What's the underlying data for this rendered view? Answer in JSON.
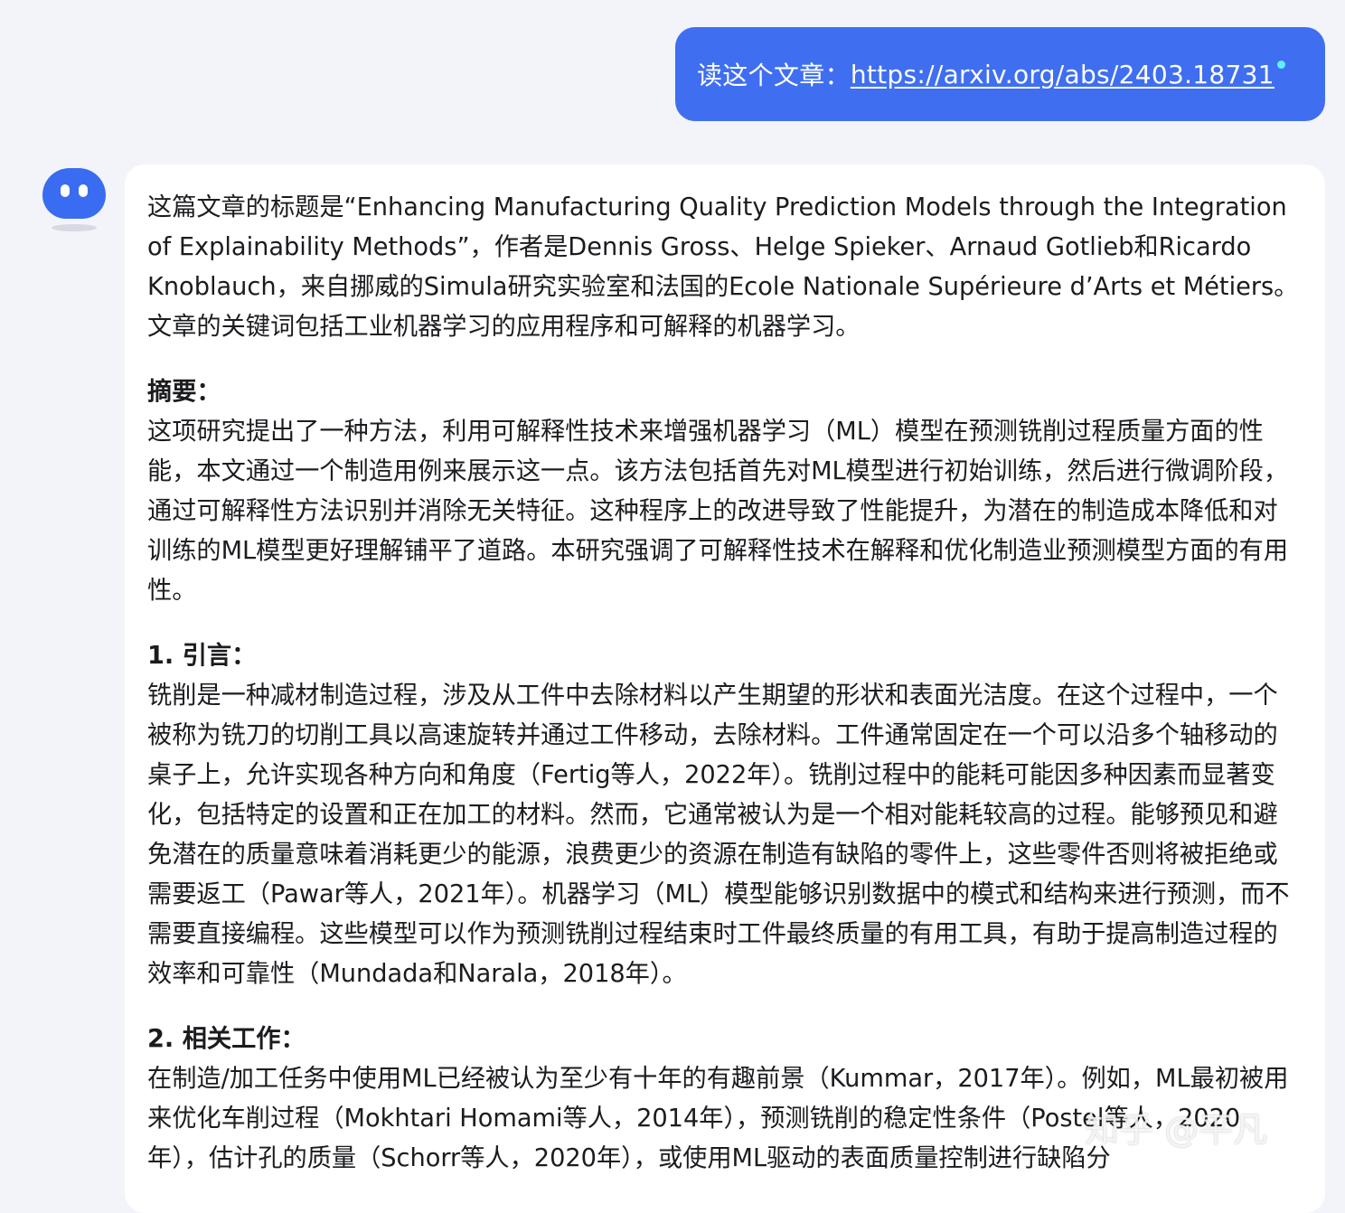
{
  "user_message": {
    "prefix": "读这个文章：",
    "link_text": "https://arxiv.org/abs/2403.18731"
  },
  "assistant_message": {
    "intro": "这篇文章的标题是“Enhancing Manufacturing Quality Prediction Models through the Integration of Explainability Methods”，作者是Dennis Gross、Helge Spieker、Arnaud Gotlieb和Ricardo Knoblauch，来自挪威的Simula研究实验室和法国的Ecole Nationale Supérieure d’Arts et Métiers。文章的关键词包括工业机器学习的应用程序和可解释的机器学习。",
    "sections": [
      {
        "title": "摘要：",
        "body": "这项研究提出了一种方法，利用可解释性技术来增强机器学习（ML）模型在预测铣削过程质量方面的性能，本文通过一个制造用例来展示这一点。该方法包括首先对ML模型进行初始训练，然后进行微调阶段，通过可解释性方法识别并消除无关特征。这种程序上的改进导致了性能提升，为潜在的制造成本降低和对训练的ML模型更好理解铺平了道路。本研究强调了可解释性技术在解释和优化制造业预测模型方面的有用性。"
      },
      {
        "title": "1. 引言：",
        "body": "铣削是一种减材制造过程，涉及从工件中去除材料以产生期望的形状和表面光洁度。在这个过程中，一个被称为铣刀的切削工具以高速旋转并通过工件移动，去除材料。工件通常固定在一个可以沿多个轴移动的桌子上，允许实现各种方向和角度（Fertig等人，2022年）。铣削过程中的能耗可能因多种因素而显著变化，包括特定的设置和正在加工的材料。然而，它通常被认为是一个相对能耗较高的过程。能够预见和避免潜在的质量意味着消耗更少的能源，浪费更少的资源在制造有缺陷的零件上，这些零件否则将被拒绝或需要返工（Pawar等人，2021年）。机器学习（ML）模型能够识别数据中的模式和结构来进行预测，而不需要直接编程。这些模型可以作为预测铣削过程结束时工件最终质量的有用工具，有助于提高制造过程的效率和可靠性（Mundada和Narala，2018年）。"
      },
      {
        "title": "2. 相关工作：",
        "body": "在制造/加工任务中使用ML已经被认为至少有十年的有趣前景（Kummar，2017年）。例如，ML最初被用来优化车削过程（Mokhtari Homami等人，2014年），预测铣削的稳定性条件（Postel等人，2020年），估计孔的质量（Schorr等人，2020年），或使用ML驱动的表面质量控制进行缺陷分"
      }
    ]
  },
  "watermark": "知乎 @平凡"
}
